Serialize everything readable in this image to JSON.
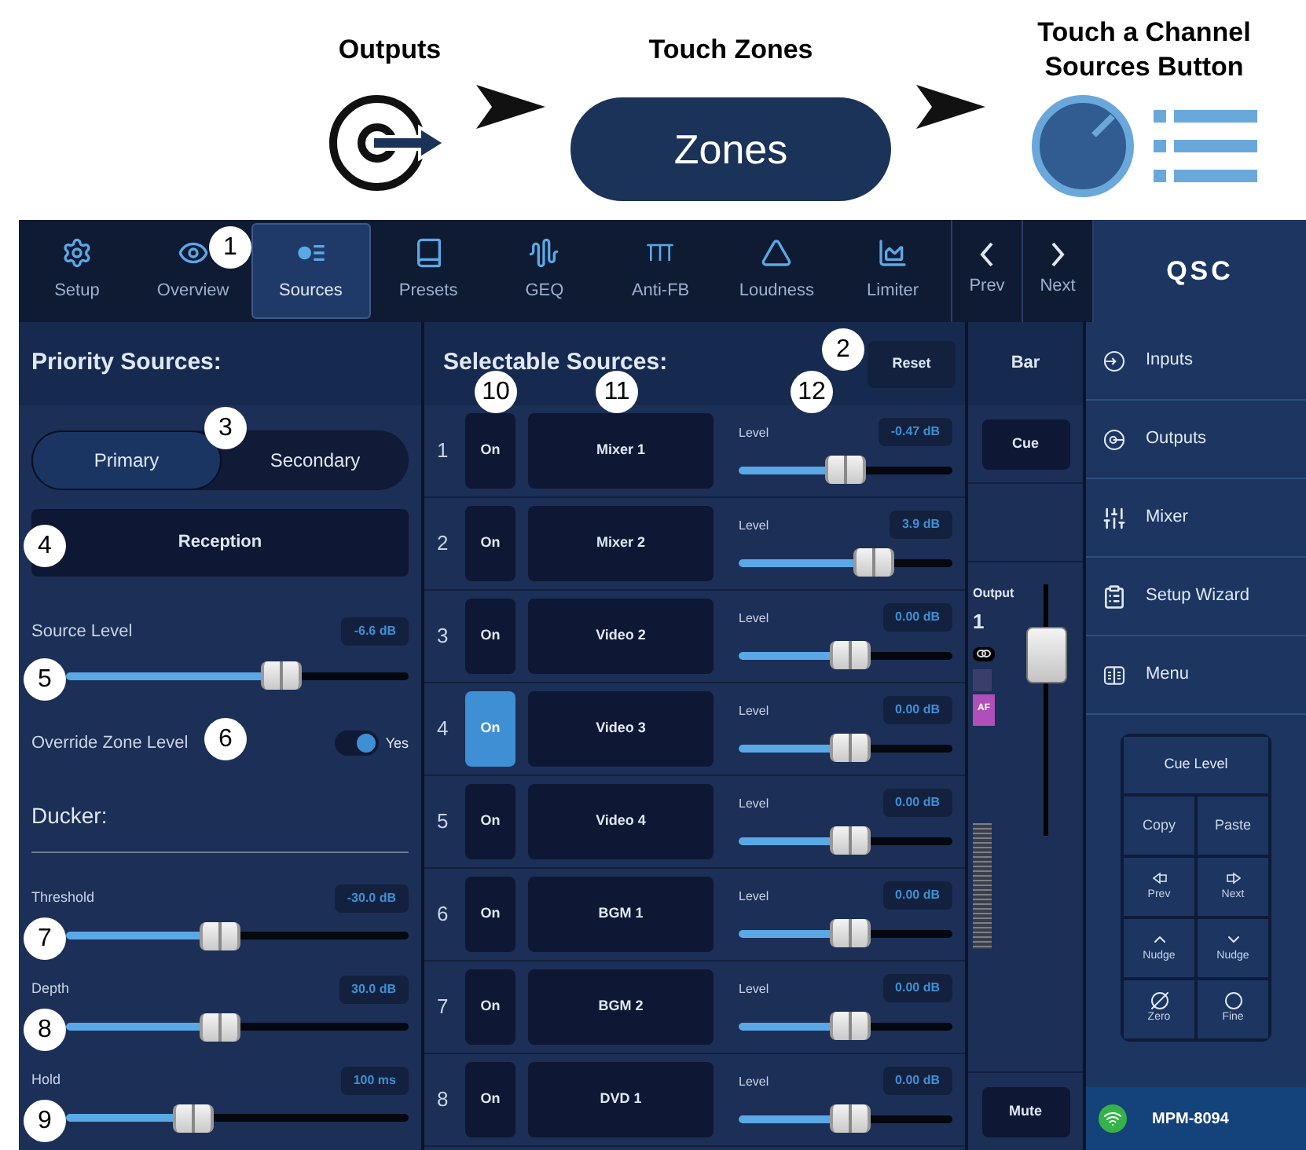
{
  "header": {
    "steps": [
      {
        "kind": "outputs",
        "label": "Outputs"
      },
      {
        "kind": "pill",
        "label": "Touch Zones",
        "button": "Zones"
      },
      {
        "kind": "knob",
        "label": "Touch a Channel Sources Button"
      }
    ]
  },
  "tabs": [
    {
      "label": "Setup",
      "selected": false
    },
    {
      "label": "Overview",
      "selected": false
    },
    {
      "label": "Sources",
      "selected": true
    },
    {
      "label": "Presets",
      "selected": false
    },
    {
      "label": "GEQ",
      "selected": false
    },
    {
      "label": "Anti-FB",
      "selected": false
    },
    {
      "label": "Loudness",
      "selected": false
    },
    {
      "label": "Limiter",
      "selected": false
    }
  ],
  "nav": {
    "prev": "Prev",
    "next": "Next"
  },
  "logo": "QSC",
  "priority": {
    "title": "Priority Sources:",
    "segments": [
      {
        "label": "Primary",
        "selected": true
      },
      {
        "label": "Secondary",
        "selected": false
      }
    ],
    "source_button": "Reception",
    "source_level": {
      "label": "Source Level",
      "reading": "-6.6 dB",
      "level": 0.63
    },
    "override": {
      "label": "Override Zone Level",
      "on": true,
      "value": "Yes"
    },
    "ducker_title": "Ducker:",
    "ducker": [
      {
        "label": "Threshold",
        "reading": "-30.0 dB",
        "level": 0.45
      },
      {
        "label": "Depth",
        "reading": "30.0 dB",
        "level": 0.45
      },
      {
        "label": "Hold",
        "reading": "100 ms",
        "level": 0.37
      }
    ]
  },
  "selectable": {
    "title": "Selectable Sources:",
    "reset": "Reset",
    "rows": [
      {
        "number": "1",
        "on_label": "On",
        "on": false,
        "source": "Mixer 1",
        "level_label": "Level",
        "reading": "-0.47 dB",
        "level": 0.5
      },
      {
        "number": "2",
        "on_label": "On",
        "on": false,
        "source": "Mixer 2",
        "level_label": "Level",
        "reading": "3.9 dB",
        "level": 0.63
      },
      {
        "number": "3",
        "on_label": "On",
        "on": false,
        "source": "Video 2",
        "level_label": "Level",
        "reading": "0.00 dB",
        "level": 0.52
      },
      {
        "number": "4",
        "on_label": "On",
        "on": true,
        "source": "Video 3",
        "level_label": "Level",
        "reading": "0.00 dB",
        "level": 0.52
      },
      {
        "number": "5",
        "on_label": "On",
        "on": false,
        "source": "Video 4",
        "level_label": "Level",
        "reading": "0.00 dB",
        "level": 0.52
      },
      {
        "number": "6",
        "on_label": "On",
        "on": false,
        "source": "BGM 1",
        "level_label": "Level",
        "reading": "0.00 dB",
        "level": 0.52
      },
      {
        "number": "7",
        "on_label": "On",
        "on": false,
        "source": "BGM 2",
        "level_label": "Level",
        "reading": "0.00 dB",
        "level": 0.52
      },
      {
        "number": "8",
        "on_label": "On",
        "on": false,
        "source": "DVD 1",
        "level_label": "Level",
        "reading": "0.00 dB",
        "level": 0.52
      }
    ]
  },
  "bar": {
    "title": "Bar",
    "cue": "Cue",
    "output_label": "Output",
    "output_number": "1",
    "af": "AF",
    "fader": {
      "level": 0.78
    },
    "mute": "Mute"
  },
  "sidebar": {
    "items": [
      {
        "label": "Inputs"
      },
      {
        "label": "Outputs"
      },
      {
        "label": "Mixer"
      },
      {
        "label": "Setup Wizard"
      },
      {
        "label": "Menu"
      }
    ],
    "keypad": {
      "title": "Cue Level",
      "keys": [
        "Copy",
        "Paste",
        "Prev",
        "Next",
        "Nudge",
        "Nudge",
        "Zero",
        "Fine"
      ]
    },
    "device": "MPM-8094"
  },
  "callouts": [
    "1",
    "2",
    "3",
    "4",
    "5",
    "6",
    "7",
    "8",
    "9",
    "10",
    "11",
    "12"
  ]
}
